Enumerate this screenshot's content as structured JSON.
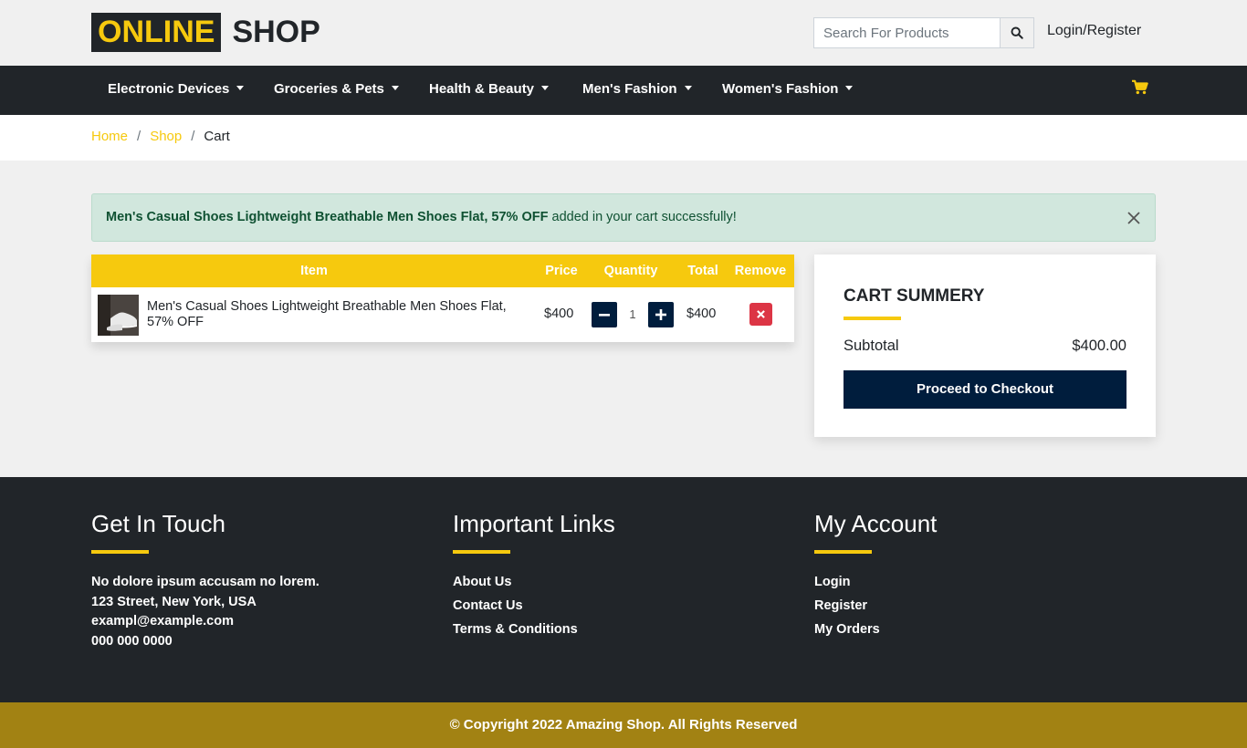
{
  "brand": {
    "part1": "ONLINE",
    "part2": "SHOP"
  },
  "search": {
    "placeholder": "Search For Products"
  },
  "header": {
    "login_label": "Login/Register"
  },
  "nav": {
    "items": [
      {
        "label": "Electronic Devices"
      },
      {
        "label": "Groceries & Pets"
      },
      {
        "label": "Health & Beauty"
      },
      {
        "label": "Men's Fashion"
      },
      {
        "label": "Women's Fashion"
      }
    ]
  },
  "breadcrumb": {
    "home": "Home",
    "shop": "Shop",
    "current": "Cart"
  },
  "alert": {
    "product": "Men's Casual Shoes Lightweight Breathable Men Shoes Flat, 57% OFF",
    "message": "added in your cart successfully!"
  },
  "cart": {
    "headers": {
      "item": "Item",
      "price": "Price",
      "quantity": "Quantity",
      "total": "Total",
      "remove": "Remove"
    },
    "rows": [
      {
        "name": "Men's Casual Shoes Lightweight Breathable Men Shoes Flat, 57% OFF",
        "price": "$400",
        "quantity": "1",
        "total": "$400"
      }
    ]
  },
  "summary": {
    "title": "CART SUMMERY",
    "subtotal_label": "Subtotal",
    "subtotal_value": "$400.00",
    "checkout_label": "Proceed to Checkout"
  },
  "footer": {
    "contact": {
      "title": "Get In Touch",
      "lines": [
        "No dolore ipsum accusam no lorem.",
        "123 Street, New York, USA",
        "exampl@example.com",
        "000 000 0000"
      ]
    },
    "links": {
      "title": "Important Links",
      "items": [
        "About Us",
        "Contact Us",
        "Terms & Conditions"
      ]
    },
    "account": {
      "title": "My Account",
      "items": [
        "Login",
        "Register",
        "My Orders"
      ]
    },
    "copyright": "© Copyright 2022 Amazing Shop. All Rights Reserved"
  },
  "colors": {
    "accent": "#f6c90e",
    "dark": "#212529",
    "navy": "#001d3d",
    "danger": "#dc3545",
    "footer_bottom": "#a28213"
  }
}
